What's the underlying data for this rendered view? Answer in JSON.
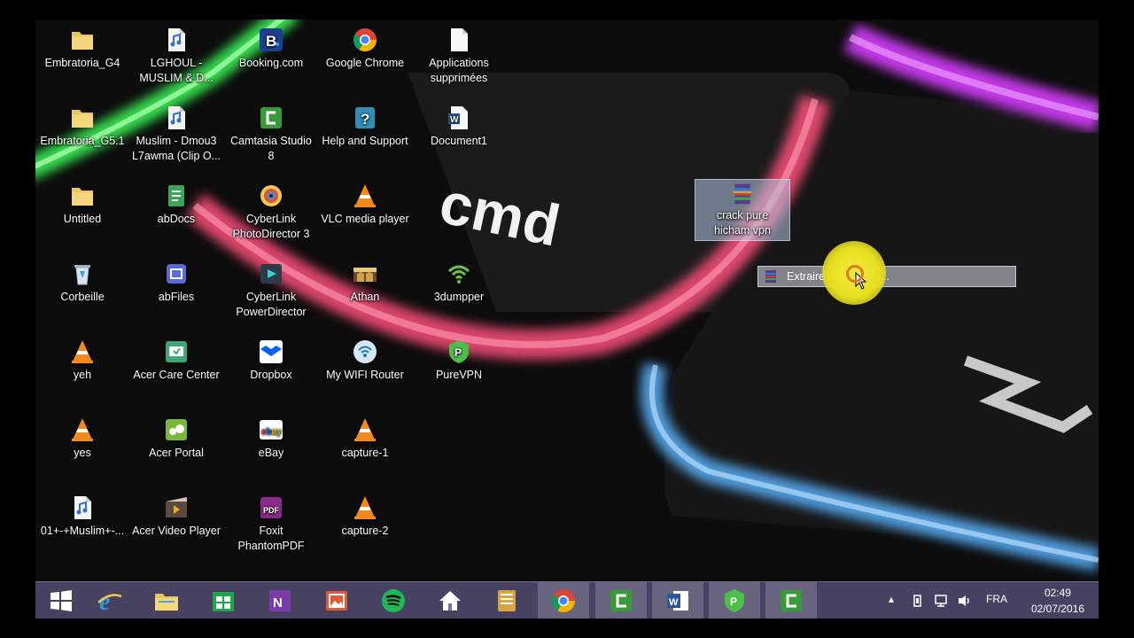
{
  "desktop": {
    "icons": [
      {
        "label": "Embratoria_G4",
        "icon": "folder-icon"
      },
      {
        "label": "LGHOUL - MUSLIM & D...",
        "icon": "audio-file-icon"
      },
      {
        "label": "Booking.com",
        "icon": "booking-icon"
      },
      {
        "label": "Google Chrome",
        "icon": "chrome-icon"
      },
      {
        "label": "Applications supprimées",
        "icon": "document-icon"
      },
      {
        "label": "Embratoria_G5.1",
        "icon": "folder-icon"
      },
      {
        "label": "Muslim - Dmou3 L7awma (Clip O...",
        "icon": "audio-file-icon"
      },
      {
        "label": "Camtasia Studio 8",
        "icon": "camtasia-icon"
      },
      {
        "label": "Help and Support",
        "icon": "help-icon"
      },
      {
        "label": "Document1",
        "icon": "word-document-icon"
      },
      {
        "label": "Untitled",
        "icon": "folder-icon"
      },
      {
        "label": "abDocs",
        "icon": "abdocs-icon"
      },
      {
        "label": "CyberLink PhotoDirector 3",
        "icon": "photodirector-icon"
      },
      {
        "label": "VLC media player",
        "icon": "vlc-icon"
      },
      {
        "label": "Corbeille",
        "icon": "recycle-bin-icon"
      },
      {
        "label": "abFiles",
        "icon": "abfiles-icon"
      },
      {
        "label": "CyberLink PowerDirector",
        "icon": "powerdirector-icon"
      },
      {
        "label": "Athan",
        "icon": "athan-icon"
      },
      {
        "label": "3dumpper",
        "icon": "wifi-icon"
      },
      {
        "label": "yeh",
        "icon": "vlc-icon"
      },
      {
        "label": "Acer Care Center",
        "icon": "acer-care-icon"
      },
      {
        "label": "Dropbox",
        "icon": "dropbox-icon"
      },
      {
        "label": "My WIFI Router",
        "icon": "wifi-router-icon"
      },
      {
        "label": "PureVPN",
        "icon": "purevpn-icon"
      },
      {
        "label": "yes",
        "icon": "vlc-icon"
      },
      {
        "label": "Acer Portal",
        "icon": "acer-portal-icon"
      },
      {
        "label": "eBay",
        "icon": "ebay-icon"
      },
      {
        "label": "capture-1",
        "icon": "vlc-icon"
      },
      {
        "label": "01+-+Muslim+-...",
        "icon": "audio-file-icon"
      },
      {
        "label": "Acer Video Player",
        "icon": "video-player-icon"
      },
      {
        "label": "Foxit PhantomPDF",
        "icon": "foxit-icon"
      },
      {
        "label": "capture-2",
        "icon": "vlc-icon"
      }
    ],
    "dragged_file": {
      "label": "crack pure hicham vpn",
      "icon": "winrar-icon"
    },
    "wallpaper_text": "cmd"
  },
  "context_menu": {
    "item_label": "Extraire les fichiers...",
    "icon": "winrar-icon"
  },
  "taskbar": {
    "buttons": [
      {
        "name": "start-button",
        "icon": "windows-logo-icon"
      },
      {
        "name": "internet-explorer",
        "icon": "ie-icon"
      },
      {
        "name": "file-explorer",
        "icon": "folder-icon"
      },
      {
        "name": "store",
        "icon": "store-icon"
      },
      {
        "name": "onenote",
        "icon": "onenote-icon"
      },
      {
        "name": "photos",
        "icon": "photos-icon"
      },
      {
        "name": "spotify",
        "icon": "spotify-icon"
      },
      {
        "name": "home",
        "icon": "home-icon"
      },
      {
        "name": "archive",
        "icon": "archive-icon"
      },
      {
        "name": "google-chrome",
        "icon": "chrome-icon"
      },
      {
        "name": "camtasia",
        "icon": "camtasia-icon"
      },
      {
        "name": "word",
        "icon": "word-icon"
      },
      {
        "name": "purevpn",
        "icon": "purevpn-icon"
      },
      {
        "name": "camtasia-recorder",
        "icon": "camtasia-icon"
      }
    ],
    "tray": {
      "language": "FRA",
      "time": "02:49",
      "date": "02/07/2016"
    }
  },
  "colors": {
    "taskbar": "#7d70b0",
    "selection": "#b4c8e6",
    "cursor_halo": "#f3ec3c"
  }
}
